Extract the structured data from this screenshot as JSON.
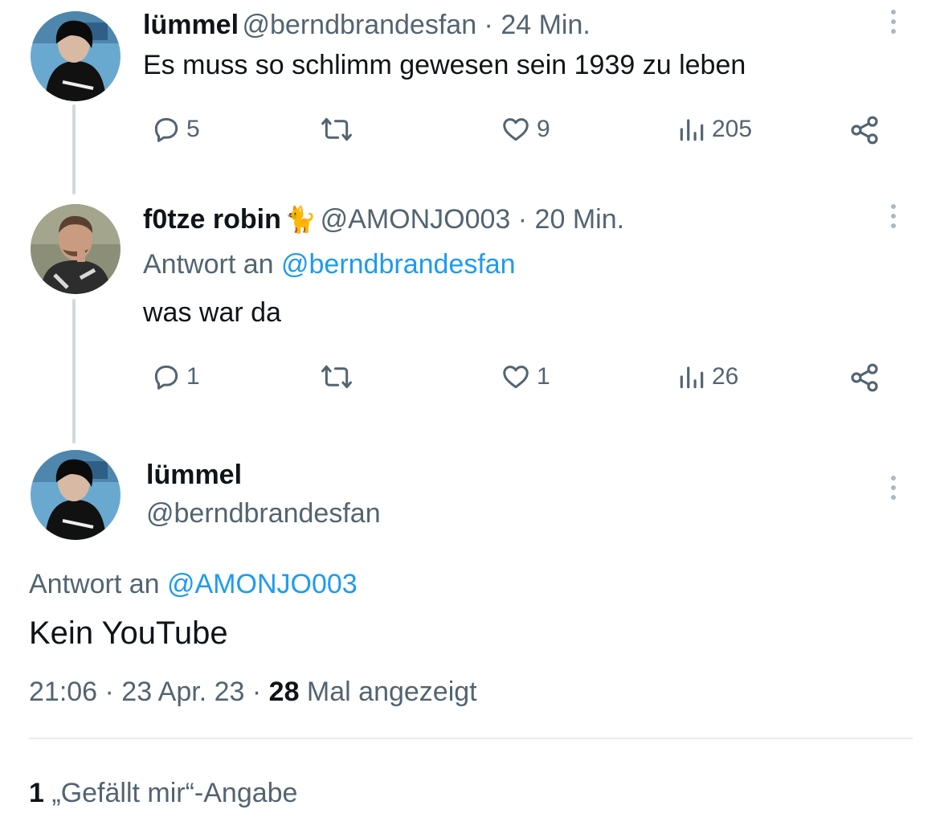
{
  "tweet1": {
    "name": "lümmel",
    "handle_time": "@berndbrandesfan · 24 Min.",
    "text": "Es muss so schlimm gewesen sein 1939 zu leben",
    "replies": "5",
    "likes": "9",
    "views": "205"
  },
  "tweet2": {
    "name": "f0tze robin",
    "emoji": "🐈",
    "handle_time": "@AMONJO003 · 20 Min.",
    "reply_prefix": "Antwort an",
    "reply_to": "@berndbrandesfan",
    "text": "was war da",
    "replies": "1",
    "likes": "1",
    "views": "26"
  },
  "main": {
    "name": "lümmel",
    "handle": "@berndbrandesfan",
    "reply_prefix": "Antwort an",
    "reply_to": "@AMONJO003",
    "text": "Kein YouTube",
    "timestamp": "21:06 · 23 Apr. 23 · ",
    "views_count": "28",
    "views_label": " Mal angezeigt",
    "likes_count": "1",
    "likes_label": " „Gefällt mir“-Angabe"
  },
  "icons": {
    "reply": "reply-icon",
    "retweet": "retweet-icon",
    "like": "heart-icon",
    "views": "views-icon",
    "share": "share-icon",
    "more": "more-icon"
  },
  "colors": {
    "link": "#1d9bf0",
    "secondary": "#536471",
    "line": "#cfd9de"
  }
}
